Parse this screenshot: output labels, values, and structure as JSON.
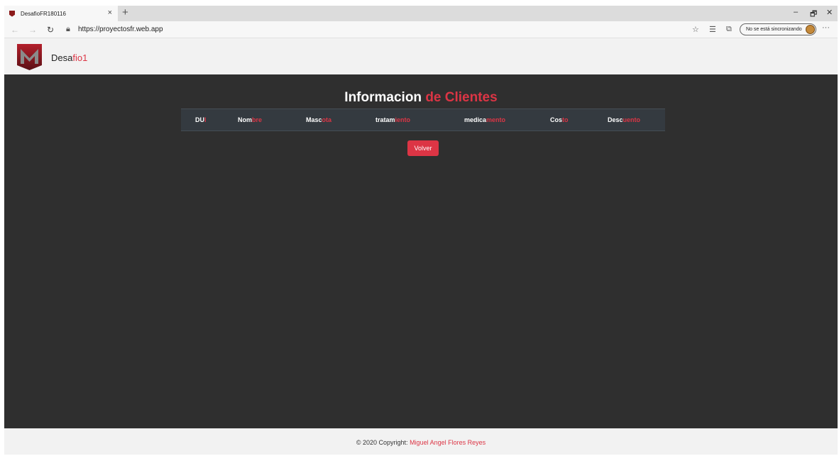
{
  "browser": {
    "tab_title": "DesafioFR180116",
    "tab_close": "×",
    "new_tab": "+",
    "url": "https://proyectosfr.web.app",
    "sync_label": "No se está sincronizando",
    "win_minimize": "–",
    "win_restore": "🗗",
    "win_close": "✕",
    "more": "···"
  },
  "navbar": {
    "brand_prefix": "Desa",
    "brand_suffix": "fio1"
  },
  "main": {
    "title_white": "Informacion",
    "title_red": "de Clientes",
    "columns": [
      {
        "white": "DU",
        "red": "I"
      },
      {
        "white": "Nom",
        "red": "bre"
      },
      {
        "white": "Masc",
        "red": "ota"
      },
      {
        "white": "tratam",
        "red": "iento"
      },
      {
        "white": "medica",
        "red": "mento"
      },
      {
        "white": "Cos",
        "red": "to"
      },
      {
        "white": "Desc",
        "red": "uento"
      }
    ],
    "back_button": "Volver"
  },
  "footer": {
    "copyright": "© 2020 Copyright: ",
    "author": "Miguel Angel Flores Reyes"
  },
  "colors": {
    "accent": "#dc3545",
    "main_bg": "#2f2f2f",
    "table_header_bg": "#343a40"
  }
}
